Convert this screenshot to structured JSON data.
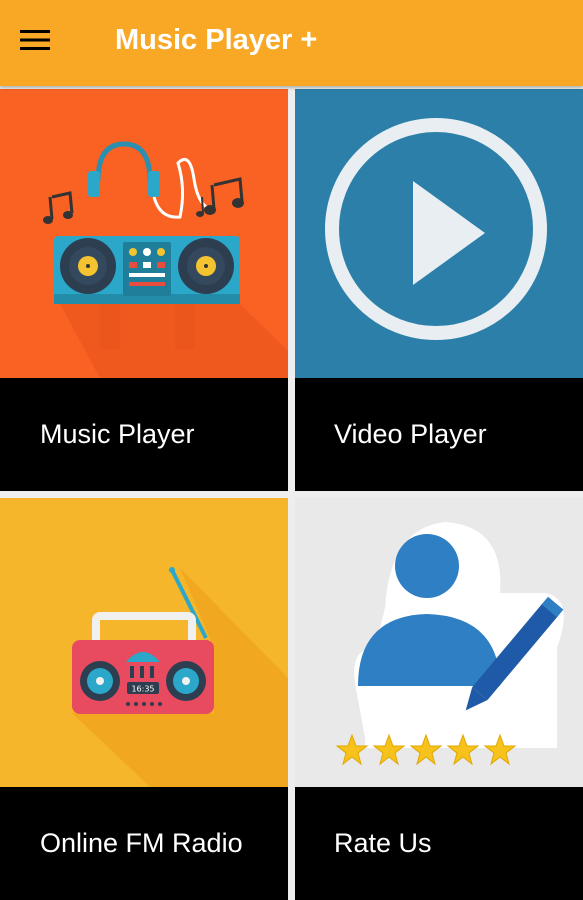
{
  "app_bar": {
    "title": "Music Player +",
    "menu_icon": "hamburger-menu-icon",
    "background": "#f9a825"
  },
  "tiles": [
    {
      "label": "Music Player",
      "icon": "dj-turntable-icon",
      "background": "#f96223"
    },
    {
      "label": "Video Player",
      "icon": "play-circle-icon",
      "background": "#2b7fa8"
    },
    {
      "label": "Online FM Radio",
      "icon": "boombox-radio-icon",
      "background": "#f6b62b",
      "radio_display": "16:35"
    },
    {
      "label": "Rate Us",
      "icon": "user-edit-rating-icon",
      "background": "#e9e9e9",
      "rating_stars": 5
    }
  ]
}
